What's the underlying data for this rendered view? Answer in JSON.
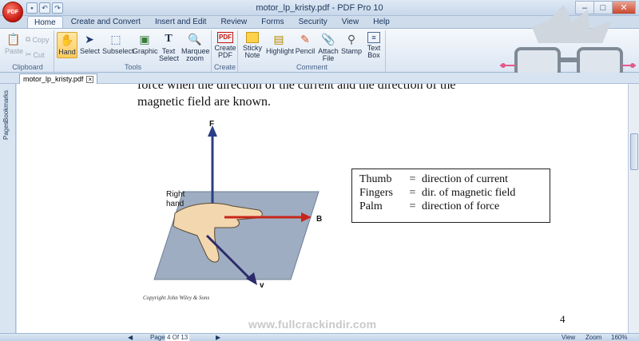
{
  "window": {
    "title": "motor_lp_kristy.pdf - PDF Pro 10",
    "orb_label": "PDF",
    "controls": [
      "–",
      "□",
      "✕"
    ]
  },
  "qat_icons": [
    "save-icon",
    "undo-icon",
    "redo-icon"
  ],
  "ribbon": {
    "tabs": [
      {
        "label": "Home",
        "active": true
      },
      {
        "label": "Create and Convert"
      },
      {
        "label": "Insert and Edit"
      },
      {
        "label": "Review"
      },
      {
        "label": "Forms"
      },
      {
        "label": "Security"
      },
      {
        "label": "View"
      },
      {
        "label": "Help"
      }
    ],
    "groups": {
      "clipboard": {
        "label": "Clipboard",
        "paste": "Paste",
        "copy": "Copy",
        "cut": "Cut"
      },
      "tools": {
        "label": "Tools",
        "hand": "Hand",
        "select": "Select",
        "subselect": "Subselect",
        "graphic": "Graphic",
        "text_select": "Text Select",
        "marquee_zoom": "Marquee zoom"
      },
      "create": {
        "label": "Create",
        "create_pdf": "Create PDF"
      },
      "comment": {
        "label": "Comment",
        "sticky_note": "Sticky Note",
        "highlight": "Highlight",
        "pencil": "Pencil",
        "attach_file": "Attach File",
        "stamp": "Stamp",
        "text_box": "Text Box"
      }
    }
  },
  "doc_tab": {
    "label": "motor_lp_kristy.pdf"
  },
  "side_tabs": {
    "bookmarks": "Bookmarks",
    "pages": "Pages"
  },
  "document": {
    "line1": "force when the direction of the current and the direction of the",
    "line2": "magnetic field are known.",
    "figure": {
      "label_f": "F",
      "label_hand_1": "Right",
      "label_hand_2": "hand",
      "label_b": "B",
      "label_v": "v",
      "copyright": "Copyright John Wiley & Sons"
    },
    "legend": [
      {
        "key": "Thumb",
        "eq": "=",
        "value": "direction of current"
      },
      {
        "key": "Fingers",
        "eq": "=",
        "value": "dir. of magnetic field"
      },
      {
        "key": "Palm",
        "eq": "=",
        "value": "direction of force"
      }
    ],
    "page_number": "4",
    "watermark": "www.fullcrackindir.com"
  },
  "status": {
    "page_label": "Page",
    "page_value": "4 Of 13",
    "view": "View",
    "zoom_label": "Zoom",
    "zoom_value": "160%"
  },
  "colors": {
    "accent": "#ffcb5c",
    "ribbon": "#dbe6f3",
    "field_arrow": "#c8261b",
    "force_arrow": "#2b3f86"
  }
}
